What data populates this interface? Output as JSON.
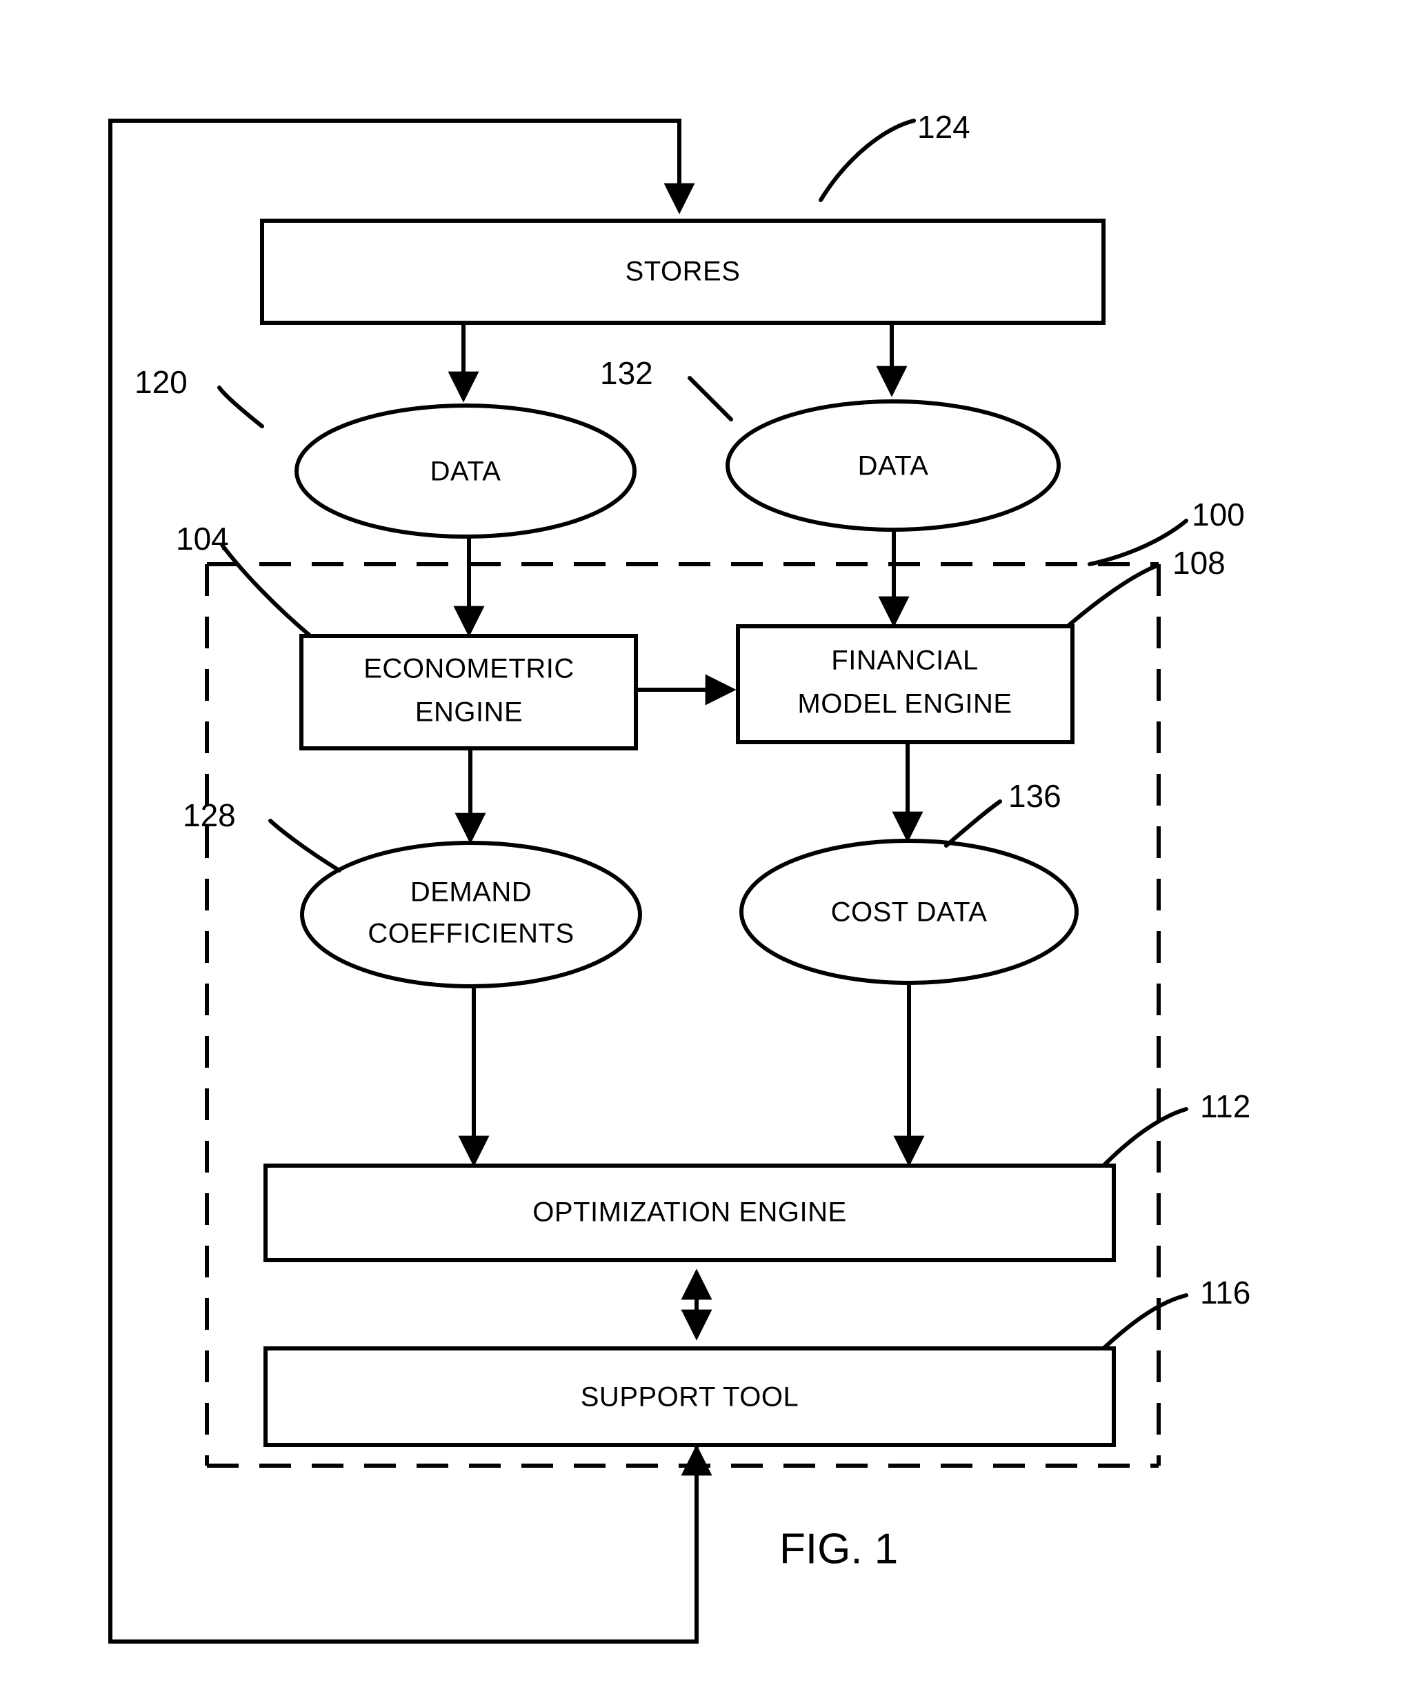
{
  "figure": {
    "caption": "FIG. 1",
    "nodes": {
      "stores": "STORES",
      "data_left": "DATA",
      "data_right": "DATA",
      "econometric_engine_line1": "ECONOMETRIC",
      "econometric_engine_line2": "ENGINE",
      "financial_model_engine_line1": "FINANCIAL",
      "financial_model_engine_line2": "MODEL ENGINE",
      "demand_coefficients_line1": "DEMAND",
      "demand_coefficients_line2": "COEFFICIENTS",
      "cost_data": "COST DATA",
      "optimization_engine": "OPTIMIZATION ENGINE",
      "support_tool": "SUPPORT TOOL"
    },
    "reference_numerals": {
      "system_boundary": "100",
      "econometric_engine": "104",
      "financial_model_engine": "108",
      "optimization_engine": "112",
      "support_tool": "116",
      "data_left": "120",
      "stores": "124",
      "demand_coefficients": "128",
      "data_right": "132",
      "cost_data": "136"
    },
    "colors": {
      "stroke": "#000000",
      "background": "#ffffff"
    }
  }
}
